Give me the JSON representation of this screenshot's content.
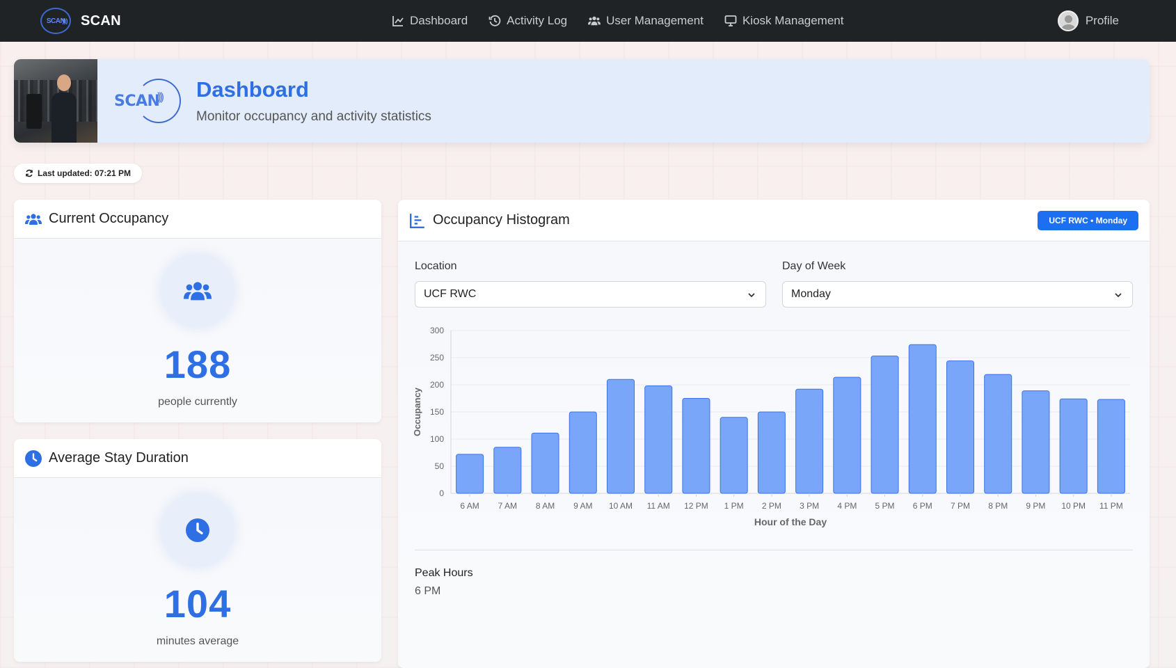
{
  "navbar": {
    "brand_logo_text": "SCAN",
    "brand_name": "SCAN",
    "links": [
      {
        "label": "Dashboard",
        "icon": "chart-line-icon"
      },
      {
        "label": "Activity Log",
        "icon": "history-icon"
      },
      {
        "label": "User Management",
        "icon": "users-icon"
      },
      {
        "label": "Kiosk Management",
        "icon": "monitor-icon"
      }
    ],
    "profile_label": "Profile"
  },
  "banner": {
    "logo_text": "SCAN",
    "title": "Dashboard",
    "subtitle": "Monitor occupancy and activity statistics"
  },
  "last_updated": "Last updated: 07:21 PM",
  "current_occupancy": {
    "title": "Current Occupancy",
    "value": "188",
    "label": "people currently"
  },
  "average_stay": {
    "title": "Average Stay Duration",
    "value": "104",
    "label": "minutes average"
  },
  "histogram": {
    "title": "Occupancy Histogram",
    "badge": "UCF RWC • Monday",
    "location_label": "Location",
    "location_value": "UCF RWC",
    "day_label": "Day of Week",
    "day_value": "Monday",
    "peak_title": "Peak Hours",
    "peak_value": "6 PM"
  },
  "colors": {
    "accent": "#2f6fe4",
    "bar_fill": "#7aa6fa",
    "bar_stroke": "#3b73e6",
    "navbar": "#1f2326"
  },
  "chart_data": {
    "type": "bar",
    "categories": [
      "6 AM",
      "7 AM",
      "8 AM",
      "9 AM",
      "10 AM",
      "11 AM",
      "12 PM",
      "1 PM",
      "2 PM",
      "3 PM",
      "4 PM",
      "5 PM",
      "6 PM",
      "7 PM",
      "8 PM",
      "9 PM",
      "10 PM",
      "11 PM"
    ],
    "values": [
      72,
      85,
      111,
      150,
      210,
      198,
      175,
      140,
      150,
      192,
      214,
      253,
      274,
      244,
      219,
      189,
      174,
      173
    ],
    "title": "",
    "xlabel": "Hour of the Day",
    "ylabel": "Occupancy",
    "ylim": [
      0,
      300
    ],
    "yticks": [
      0,
      50,
      100,
      150,
      200,
      250,
      300
    ],
    "grid": true,
    "legend": "none"
  }
}
